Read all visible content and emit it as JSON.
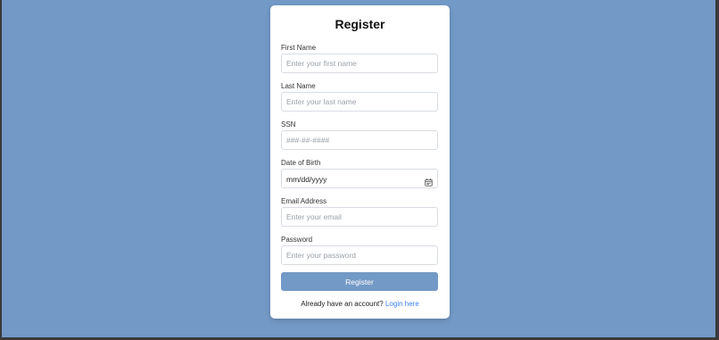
{
  "form": {
    "title": "Register",
    "fields": {
      "first_name": {
        "label": "First Name",
        "placeholder": "Enter your first name"
      },
      "last_name": {
        "label": "Last Name",
        "placeholder": "Enter your last name"
      },
      "ssn": {
        "label": "SSN",
        "placeholder": "###-##-####"
      },
      "dob": {
        "label": "Date of Birth",
        "value": "mm/dd/yyyy"
      },
      "email": {
        "label": "Email Address",
        "placeholder": "Enter your email"
      },
      "password": {
        "label": "Password",
        "placeholder": "Enter your password"
      }
    },
    "submit_label": "Register",
    "footer_text": "Already have an account?",
    "login_link": "Login here"
  },
  "colors": {
    "background": "#7399c6",
    "button": "#7399c6",
    "link": "#3b82f6",
    "card": "#ffffff"
  },
  "icons": {
    "date_picker": "calendar-icon"
  }
}
